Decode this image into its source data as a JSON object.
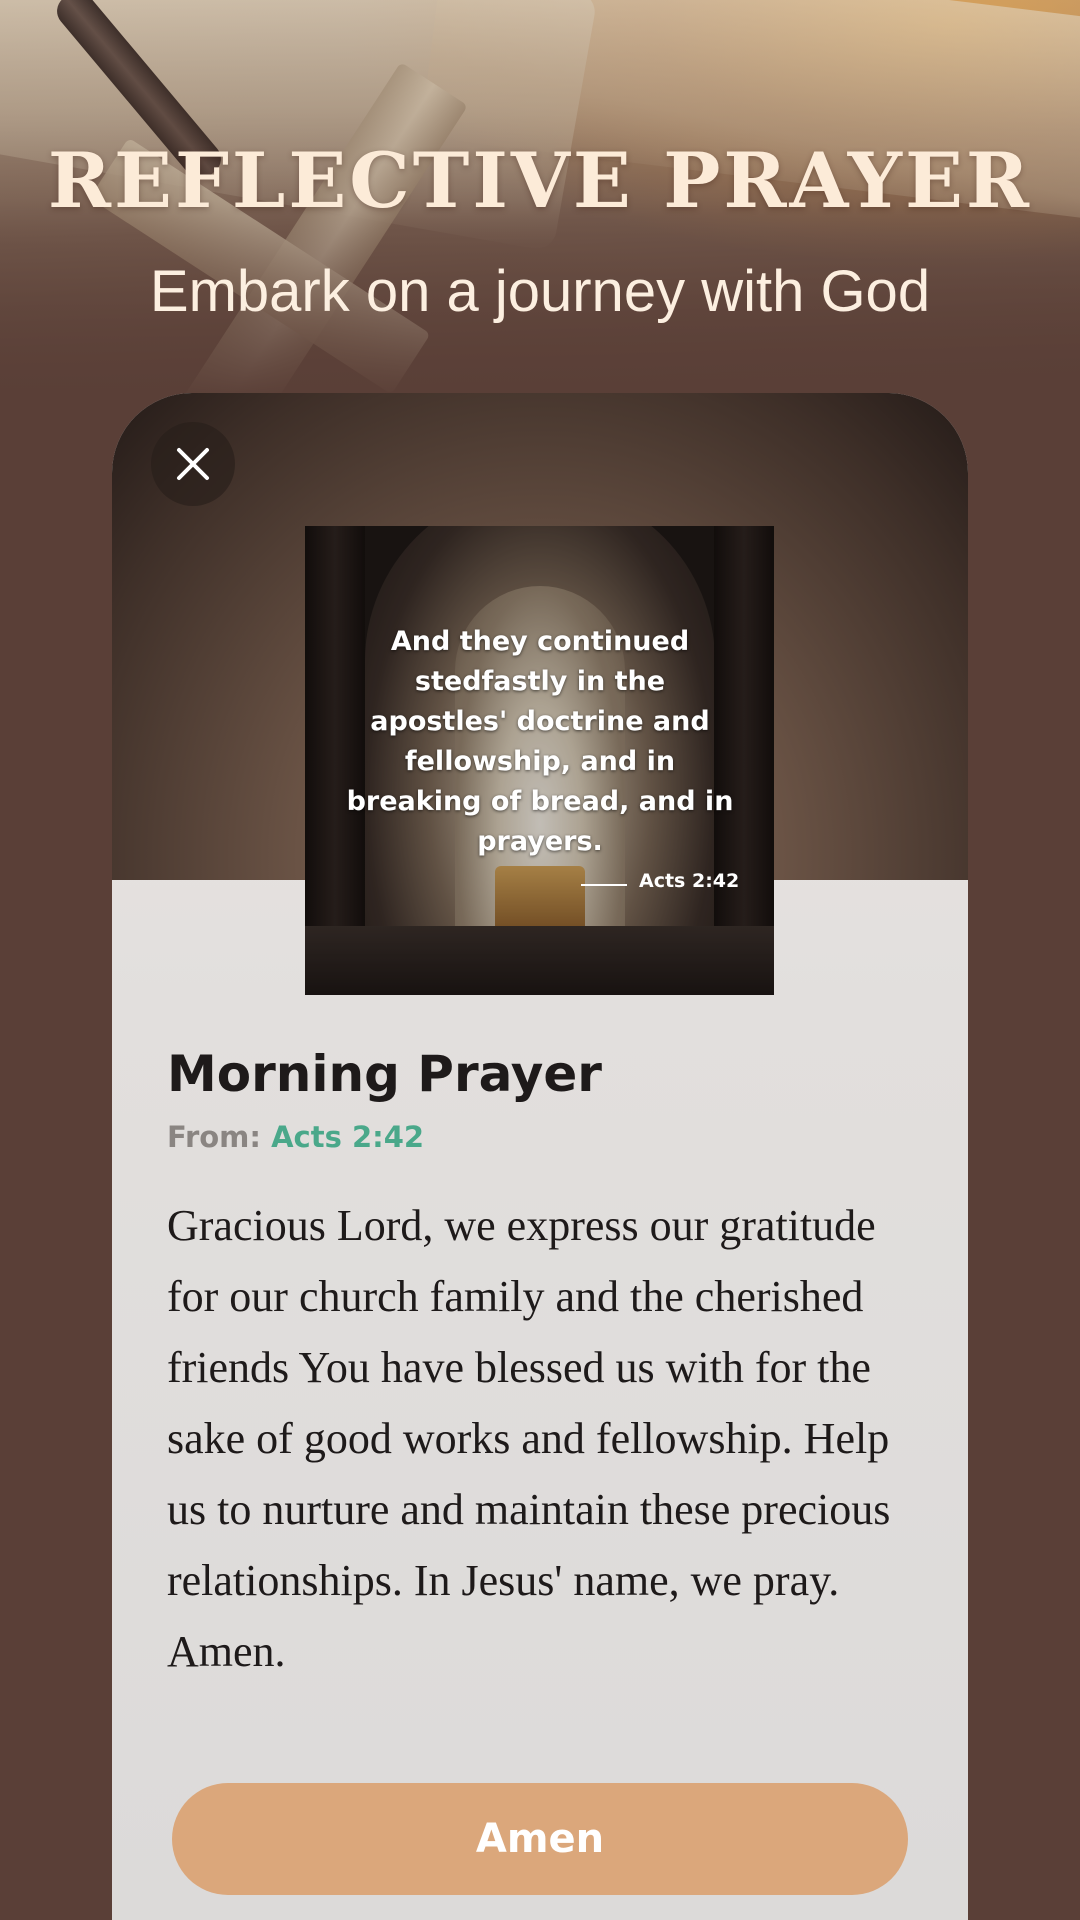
{
  "header": {
    "title": "REFLECTIVE PRAYER",
    "subtitle": "Embark on a journey with God"
  },
  "card": {
    "close_icon": "close-icon",
    "verse_image": {
      "text": "And they continued stedfastly in the apostles' doctrine and fellowship, and in breaking of bread, and in prayers.",
      "reference": "Acts 2:42"
    },
    "prayer_title": "Morning Prayer",
    "source_label": "From:",
    "source_ref": "Acts 2:42",
    "prayer_text": "Gracious Lord, we express our gratitude for our church family and the cherished friends You have blessed us with for the sake of good works and fellowship. Help us to nurture and maintain these precious relationships. In Jesus' name, we pray. Amen.",
    "amen_label": "Amen"
  },
  "colors": {
    "background": "#5a3f37",
    "accent": "#dba77b",
    "link": "#4aa88a",
    "headline": "#fcebd8"
  }
}
